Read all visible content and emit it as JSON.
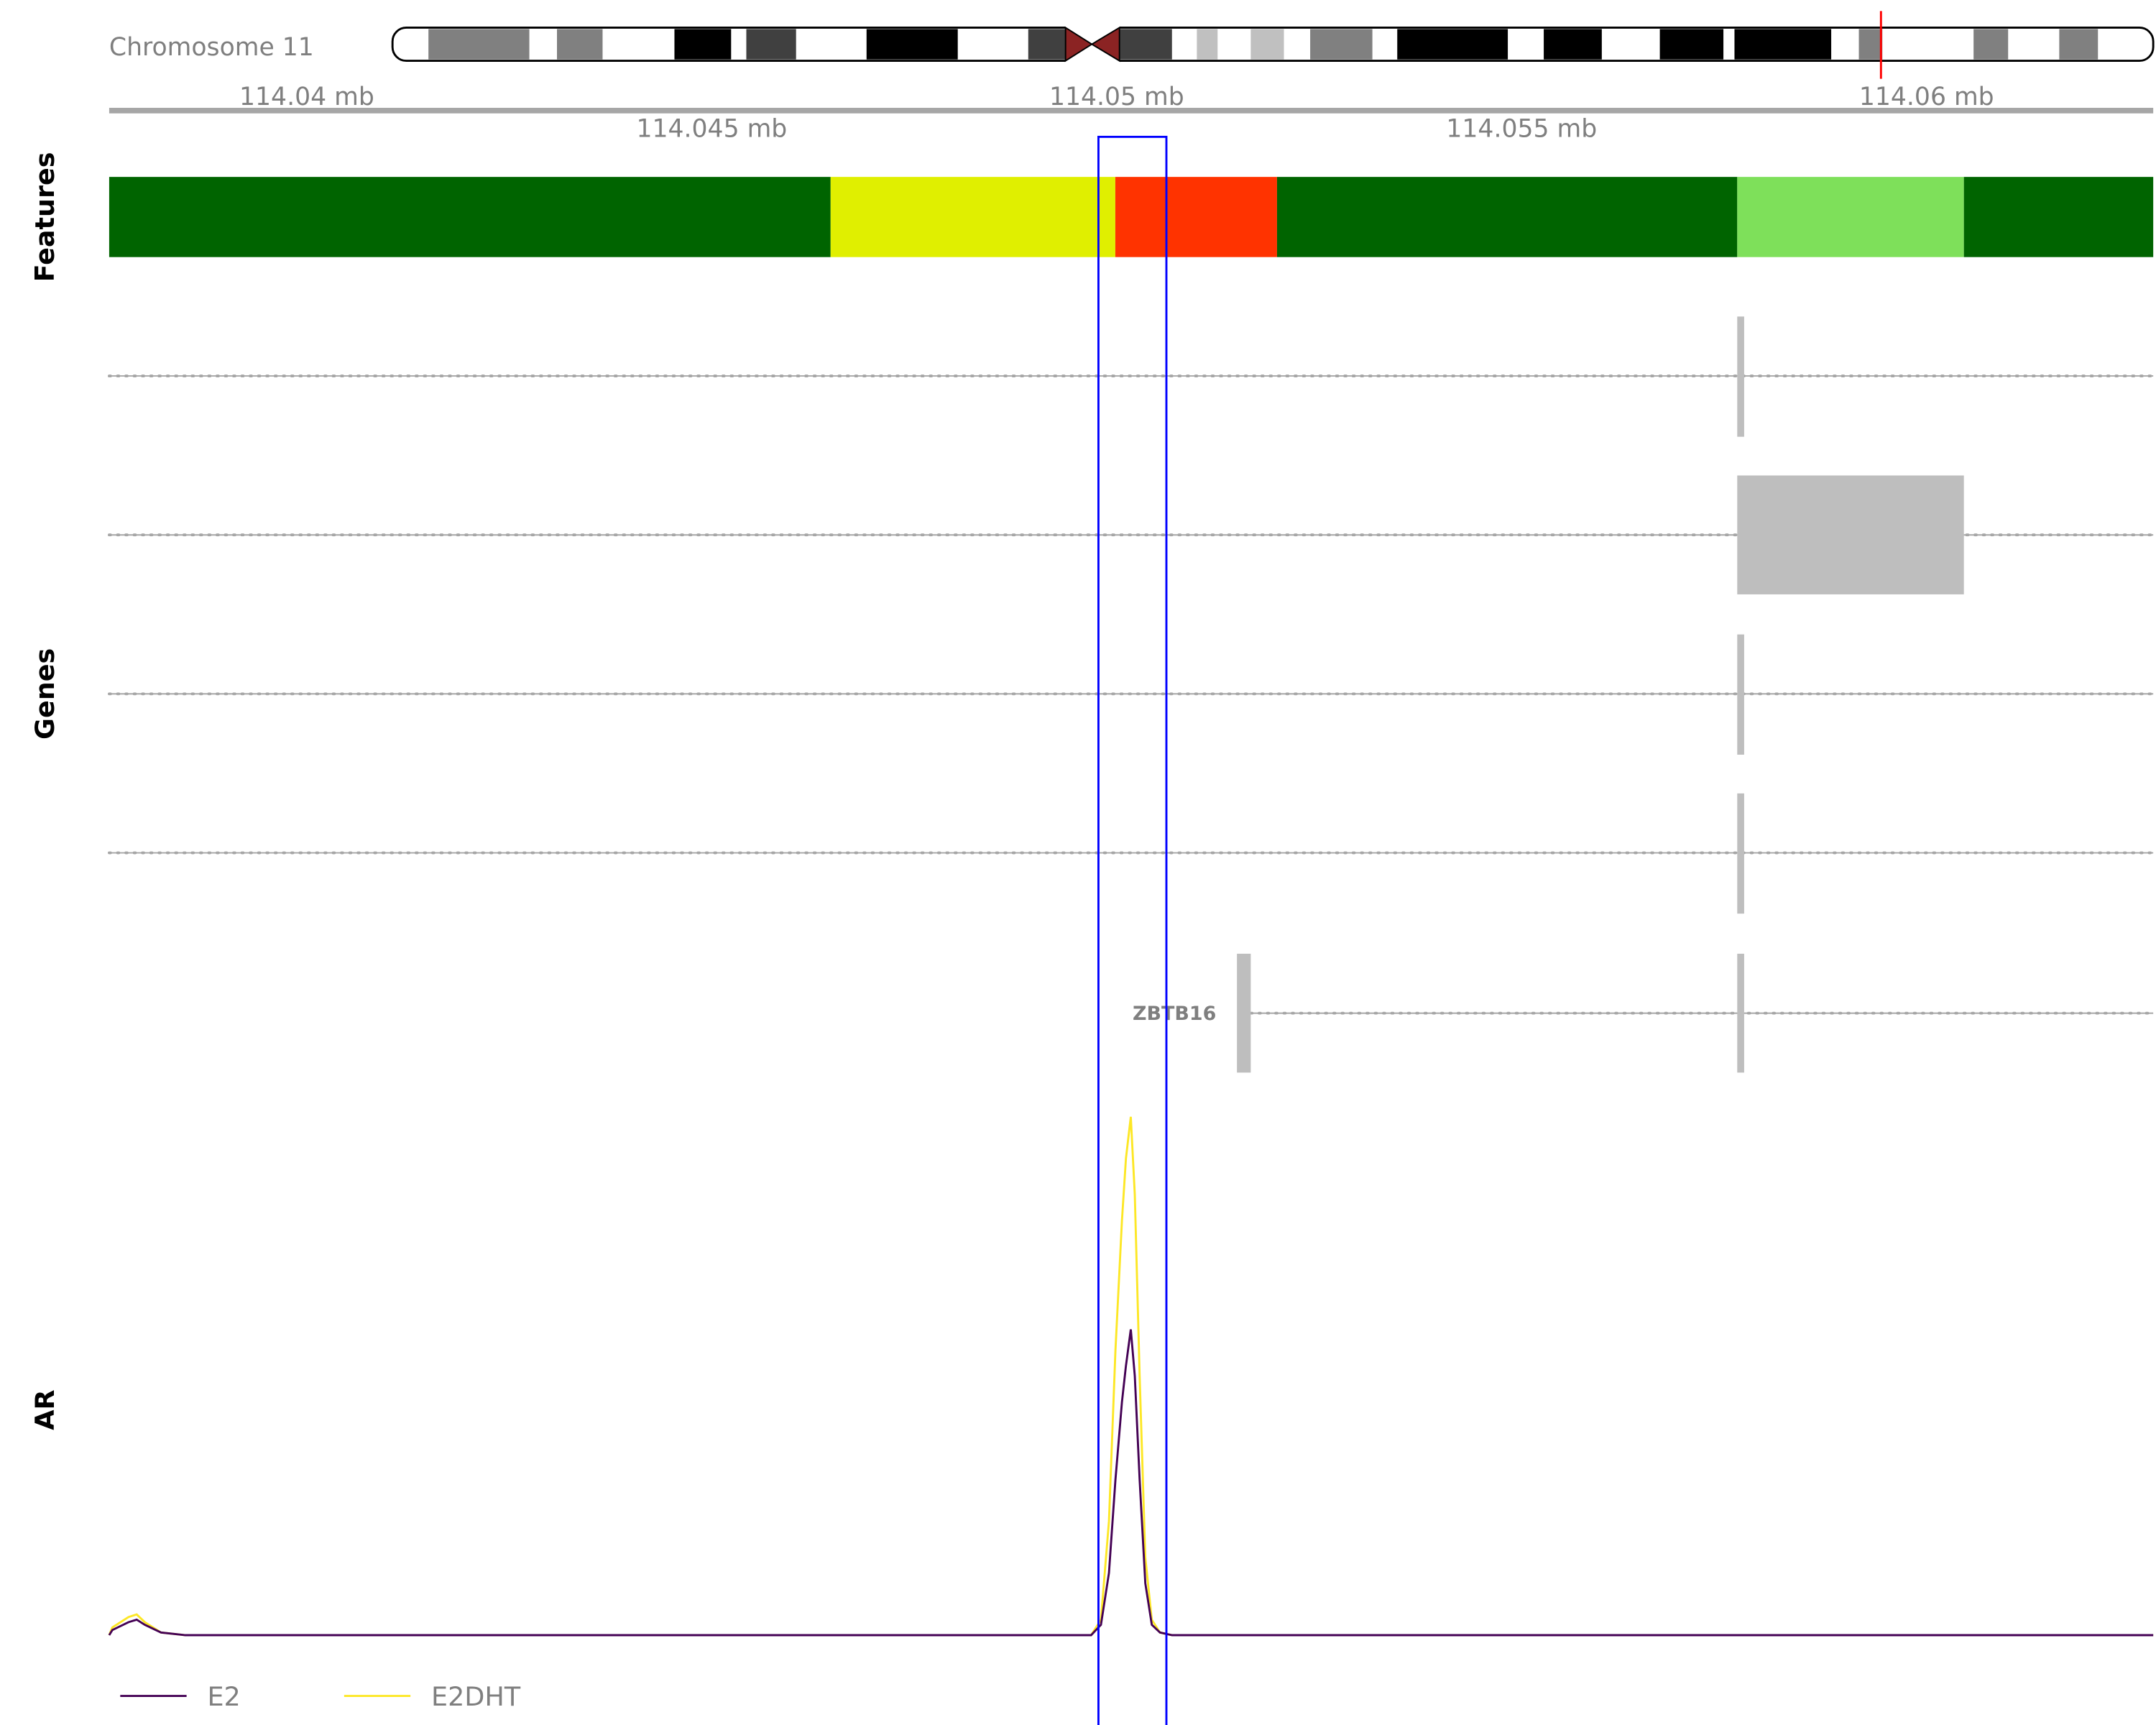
{
  "chromosome": {
    "label": "Chromosome 11"
  },
  "axis": {
    "ticks_top": [
      "114.04 mb",
      "114.05 mb",
      "114.06 mb"
    ],
    "ticks_bottom": [
      "114.045 mb",
      "114.055 mb"
    ]
  },
  "tracks": {
    "features": "Features",
    "genes": "Genes",
    "ar": "AR"
  },
  "genes": {
    "label": "ZBTB16"
  },
  "colors": {
    "highlight": "#0000ff",
    "gene": "#bebebe",
    "E2": "#440154",
    "E2DHT": "#fde725",
    "feature_palette": [
      "#006400",
      "#e0ef00",
      "#ff3300",
      "#006400",
      "#7ee05a",
      "#006400"
    ]
  },
  "chart_data": {
    "type": "line",
    "title": "",
    "xlabel": "",
    "ylabel": "AR",
    "xlim": [
      114.03756,
      114.06283
    ],
    "ylim": [
      0,
      1.05
    ],
    "x": [
      114.03756,
      114.0376,
      114.0378,
      114.0379,
      114.038,
      114.0382,
      114.0385,
      114.045,
      114.0497,
      114.04982,
      114.04992,
      114.05,
      114.05008,
      114.05013,
      114.05019,
      114.05024,
      114.0503,
      114.05037,
      114.05045,
      114.05055,
      114.0507,
      114.055,
      114.06283
    ],
    "series": [
      {
        "name": "E2",
        "values": [
          0,
          0.01,
          0.025,
          0.03,
          0.02,
          0.005,
          0,
          0,
          0,
          0.02,
          0.12,
          0.3,
          0.45,
          0.52,
          0.59,
          0.5,
          0.3,
          0.1,
          0.02,
          0.005,
          0,
          0,
          0
        ]
      },
      {
        "name": "E2DHT",
        "values": [
          0,
          0.015,
          0.035,
          0.04,
          0.025,
          0.005,
          0,
          0,
          0,
          0.03,
          0.22,
          0.55,
          0.8,
          0.92,
          1.0,
          0.85,
          0.5,
          0.15,
          0.03,
          0.005,
          0,
          0,
          0
        ]
      }
    ],
    "legend": [
      "E2",
      "E2DHT"
    ],
    "legend_position": "bottom-left",
    "highlight_range_mb": [
      114.04979,
      114.05063
    ]
  }
}
